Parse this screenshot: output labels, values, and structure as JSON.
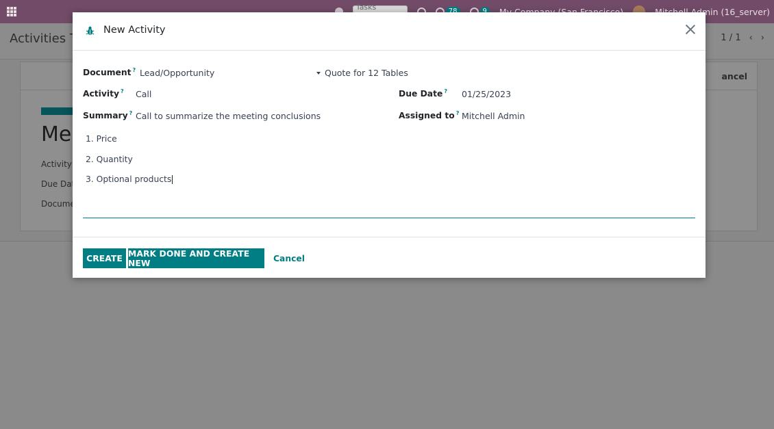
{
  "topbar": {
    "search_placeholder": "Tasks search...",
    "messages_count": "78",
    "activities_count": "9",
    "company": "My Company (San Francisco)",
    "user": "Mitchell Admin (16_server)"
  },
  "control_panel": {
    "breadcrumb": "Activities To",
    "pager": "1 / 1"
  },
  "background_record": {
    "cancel_label": "ancel",
    "title": "Me",
    "labels": [
      "Activity",
      "Due Dat",
      "Docume"
    ]
  },
  "modal": {
    "title": "New Activity",
    "fields": {
      "document_label": "Document",
      "document_model": "Lead/Opportunity",
      "document_record": "Quote for 12 Tables",
      "activity_label": "Activity",
      "activity_value": "Call",
      "summary_label": "Summary",
      "summary_value": "Call to summarize the meeting conclusions",
      "due_date_label": "Due Date",
      "due_date_value": "01/25/2023",
      "assigned_label": "Assigned to",
      "assigned_value": "Mitchell Admin",
      "help_mark": "?"
    },
    "note_lines": [
      "1. Price",
      "2. Quantity",
      "3. Optional products"
    ],
    "buttons": {
      "create": "CREATE",
      "mark_done": "MARK DONE AND CREATE NEW",
      "cancel": "Cancel"
    }
  },
  "colors": {
    "accent": "#017e84",
    "navbar": "#714B67"
  }
}
